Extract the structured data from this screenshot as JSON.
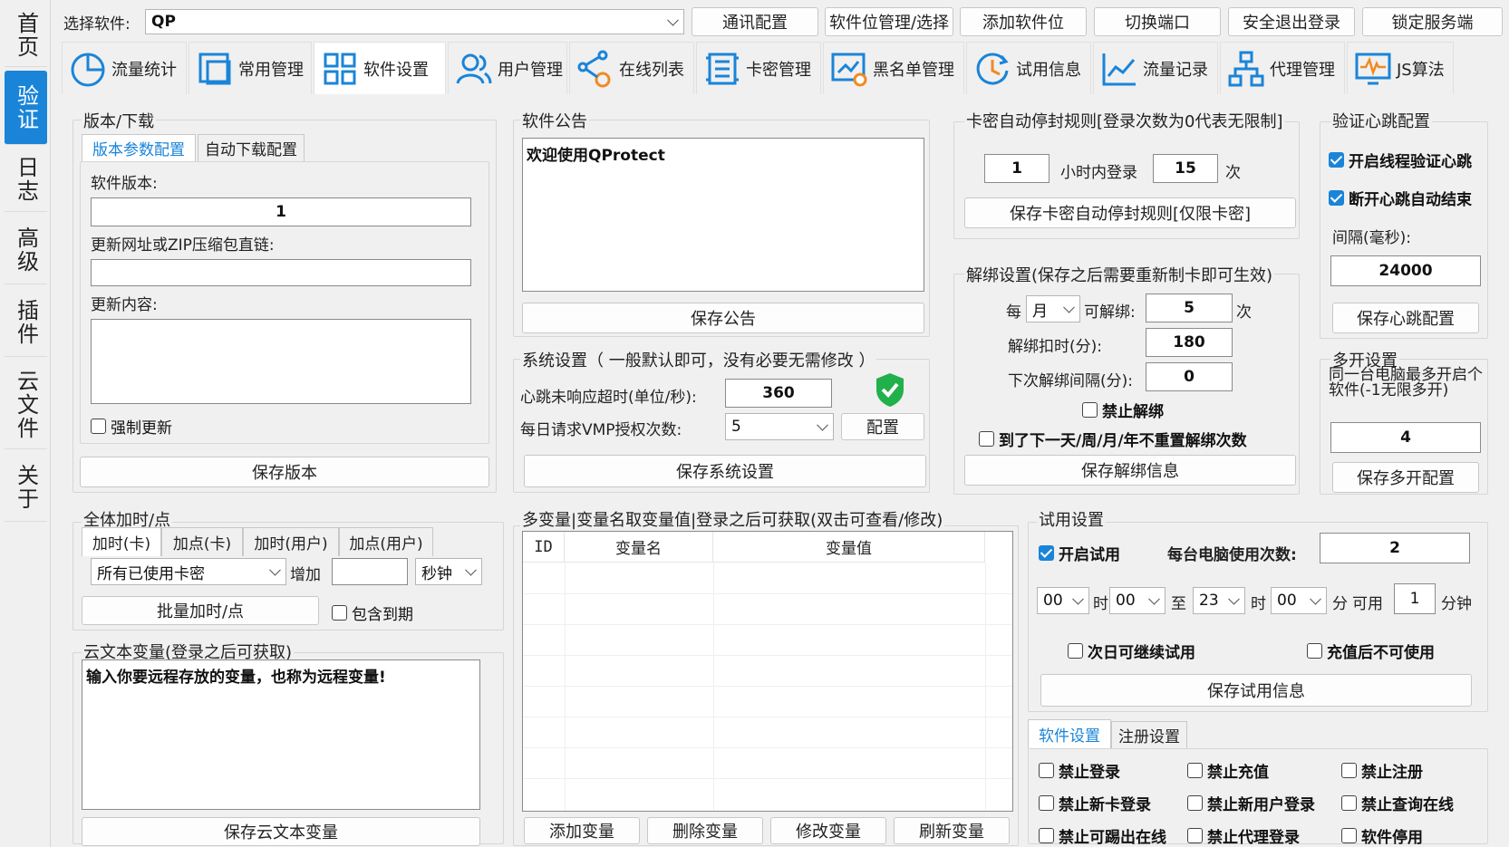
{
  "sidebar": {
    "items": [
      {
        "label": "首页"
      },
      {
        "label": "验证",
        "active": true
      },
      {
        "label": "日志"
      },
      {
        "label": "高级"
      },
      {
        "label": "插件"
      },
      {
        "label": "云文件"
      },
      {
        "label": "关于"
      }
    ]
  },
  "topbar": {
    "select_label": "选择软件:",
    "select_value": "QP",
    "buttons": [
      "通讯配置",
      "软件位管理/选择",
      "添加软件位",
      "切换端口",
      "安全退出登录",
      "锁定服务端"
    ]
  },
  "tabs": [
    {
      "label": "流量统计",
      "icon": "pie-chart-icon"
    },
    {
      "label": "常用管理",
      "icon": "window-icon"
    },
    {
      "label": "软件设置",
      "icon": "grid-icon",
      "active": true
    },
    {
      "label": "用户管理",
      "icon": "users-icon"
    },
    {
      "label": "在线列表",
      "icon": "share-icon"
    },
    {
      "label": "卡密管理",
      "icon": "card-icon"
    },
    {
      "label": "黑名单管理",
      "icon": "blacklist-icon"
    },
    {
      "label": "试用信息",
      "icon": "clock-icon"
    },
    {
      "label": "流量记录",
      "icon": "line-chart-icon"
    },
    {
      "label": "代理管理",
      "icon": "hierarchy-icon"
    },
    {
      "label": "JS算法",
      "icon": "waveform-icon"
    }
  ],
  "version": {
    "title": "版本/下载",
    "subtabs": [
      "版本参数配置",
      "自动下载配置"
    ],
    "version_label": "软件版本:",
    "version_value": "1",
    "url_label": "更新网址或ZIP压缩包直链:",
    "url_value": "",
    "content_label": "更新内容:",
    "content_value": "",
    "force_update": "强制更新",
    "save_button": "保存版本"
  },
  "notice": {
    "title": "软件公告",
    "content": "欢迎使用QProtect",
    "save_button": "保存公告"
  },
  "system": {
    "title": "系统设置（ 一般默认即可，没有必要无需修改 ）",
    "heartbeat_label": "心跳未响应超时(单位/秒):",
    "heartbeat_value": "360",
    "vmp_label": "每日请求VMP授权次数:",
    "vmp_value": "5",
    "config_button": "配置",
    "save_button": "保存系统设置"
  },
  "card_rule": {
    "title": "卡密自动停封规则[登录次数为0代表无限制]",
    "hours_value": "1",
    "hours_label": "小时内登录",
    "times_value": "15",
    "times_label": "次",
    "save_button": "保存卡密自动停封规则[仅限卡密]"
  },
  "unbind": {
    "title": "解绑设置(保存之后需要重新制卡即可生效)",
    "per_label": "每",
    "per_value": "月",
    "can_unbind_label": "可解绑:",
    "can_unbind_value": "5",
    "can_unbind_unit": "次",
    "deduct_label": "解绑扣时(分):",
    "deduct_value": "180",
    "interval_label": "下次解绑间隔(分):",
    "interval_value": "0",
    "forbid_unbind": "禁止解绑",
    "no_reset": "到了下一天/周/月/年不重置解绑次数",
    "save_button": "保存解绑信息"
  },
  "heartbeat": {
    "title": "验证心跳配置",
    "thread_check": "开启线程验证心跳",
    "auto_end": "断开心跳自动结束",
    "interval_label": "间隔(毫秒):",
    "interval_value": "24000",
    "save_button": "保存心跳配置"
  },
  "multi": {
    "title": "多开设置",
    "desc": "同一台电脑最多开启个软件(-1无限多开)",
    "value": "4",
    "save_button": "保存多开配置"
  },
  "batch": {
    "title": "全体加时/点",
    "subtabs": [
      "加时(卡)",
      "加点(卡)",
      "加时(用户)",
      "加点(用户)"
    ],
    "target_value": "所有已使用卡密",
    "add_label": "增加",
    "add_value": "",
    "unit_value": "秒钟",
    "save_button": "批量加时/点",
    "include_expired": "包含到期"
  },
  "cloud_text": {
    "title": "云文本变量(登录之后可获取)",
    "content": "输入你要远程存放的变量，也称为远程变量!",
    "save_button": "保存云文本变量"
  },
  "variables": {
    "title": "多变量|变量名取变量值|登录之后可获取(双击可查看/修改)",
    "columns": [
      "ID",
      "变量名",
      "变量值"
    ],
    "buttons": [
      "添加变量",
      "删除变量",
      "修改变量",
      "刷新变量"
    ]
  },
  "trial": {
    "title": "试用设置",
    "enable": "开启试用",
    "per_pc_label": "每台电脑使用次数:",
    "per_pc_value": "2",
    "from_hour": "00",
    "hour_label": "时",
    "from_min": "00",
    "to_label": "至",
    "to_hour": "23",
    "to_hour_label": "时",
    "to_min": "00",
    "min_label": "分",
    "usable_label": "可用",
    "usable_value": "1",
    "minutes_label": "分钟",
    "next_day": "次日可继续试用",
    "no_after_recharge": "充值后不可使用",
    "save_button": "保存试用信息"
  },
  "soft_settings": {
    "subtabs": [
      "软件设置",
      "注册设置"
    ],
    "options": [
      "禁止登录",
      "禁止充值",
      "禁止注册",
      "禁止新卡登录",
      "禁止新用户登录",
      "禁止查询在线",
      "禁止可踢出在线",
      "禁止代理登录",
      "软件停用"
    ]
  },
  "colors": {
    "accent": "#1a84d8",
    "shield": "#22b04b"
  }
}
